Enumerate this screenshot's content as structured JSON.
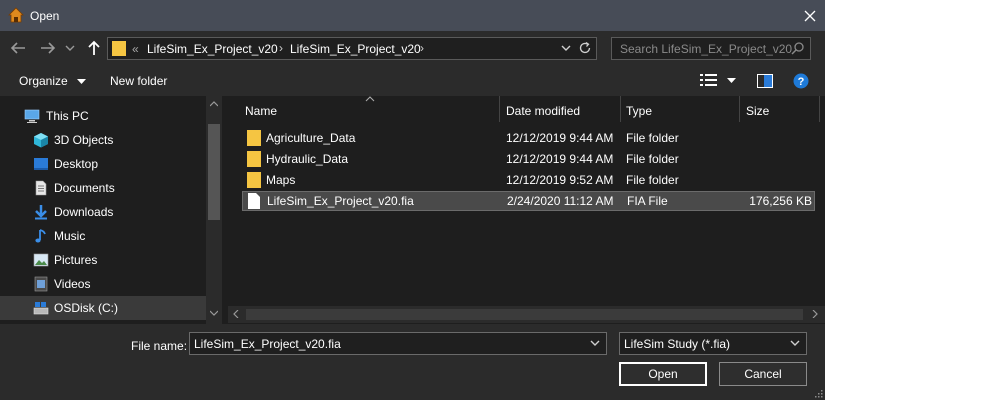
{
  "window": {
    "title": "Open"
  },
  "nav": {
    "crumb_prefix": "«",
    "crumbs": [
      "LifeSim_Ex_Project_v20",
      "LifeSim_Ex_Project_v20"
    ],
    "search_placeholder": "Search LifeSim_Ex_Project_v20"
  },
  "toolbar": {
    "organize_label": "Organize",
    "new_folder_label": "New folder"
  },
  "sidebar": {
    "items": [
      {
        "label": "This PC",
        "icon": "pc-icon"
      },
      {
        "label": "3D Objects",
        "icon": "3d-objects-icon"
      },
      {
        "label": "Desktop",
        "icon": "desktop-icon"
      },
      {
        "label": "Documents",
        "icon": "documents-icon"
      },
      {
        "label": "Downloads",
        "icon": "downloads-icon"
      },
      {
        "label": "Music",
        "icon": "music-icon"
      },
      {
        "label": "Pictures",
        "icon": "pictures-icon"
      },
      {
        "label": "Videos",
        "icon": "videos-icon"
      },
      {
        "label": "OSDisk (C:)",
        "icon": "drive-icon"
      }
    ]
  },
  "columns": {
    "name": "Name",
    "date": "Date modified",
    "type": "Type",
    "size": "Size"
  },
  "files": [
    {
      "name": "Agriculture_Data",
      "date": "12/12/2019 9:44 AM",
      "type": "File folder",
      "size": "",
      "kind": "folder"
    },
    {
      "name": "Hydraulic_Data",
      "date": "12/12/2019 9:44 AM",
      "type": "File folder",
      "size": "",
      "kind": "folder"
    },
    {
      "name": "Maps",
      "date": "12/12/2019 9:52 AM",
      "type": "File folder",
      "size": "",
      "kind": "folder"
    },
    {
      "name": "LifeSim_Ex_Project_v20.fia",
      "date": "2/24/2020 11:12 AM",
      "type": "FIA File",
      "size": "176,256 KB",
      "kind": "file"
    }
  ],
  "bottom": {
    "file_name_label": "File name:",
    "file_name_value": "LifeSim_Ex_Project_v20.fia",
    "filter_value": "LifeSim Study (*.fia)",
    "open_label": "Open",
    "cancel_label": "Cancel"
  },
  "colors": {
    "folder": "#f5c542",
    "accent": "#1e90ff",
    "titlebar": "#474c57"
  }
}
